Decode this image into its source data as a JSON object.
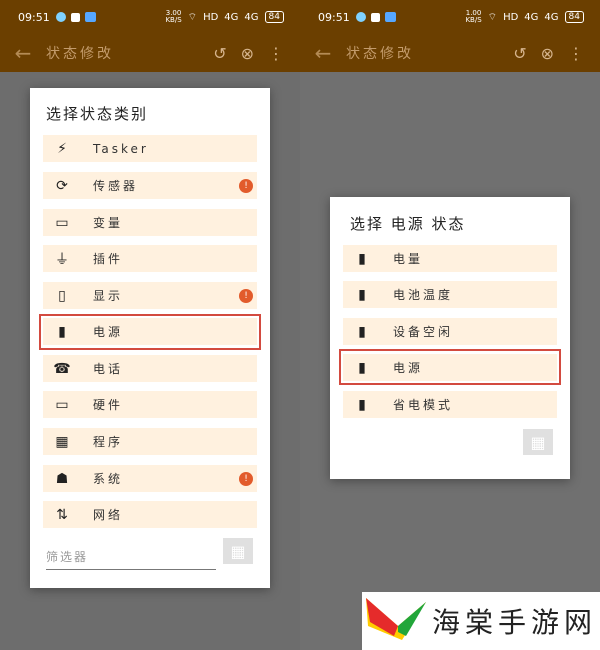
{
  "status_bar": {
    "time": "09:51",
    "left_speed": "3.00\nKB/S",
    "right_speed": "1.00\nKB/S",
    "hd": "HD",
    "signal1": "4G",
    "signal2": "4G",
    "battery": "84"
  },
  "appbar": {
    "title": "状态修改"
  },
  "left_dialog": {
    "title": "选择状态类别",
    "items": [
      {
        "label": "Tasker",
        "icon": "lightning-icon",
        "badge": ""
      },
      {
        "label": "传感器",
        "icon": "rotate-icon",
        "badge": "!"
      },
      {
        "label": "变量",
        "icon": "tag-icon",
        "badge": ""
      },
      {
        "label": "插件",
        "icon": "plug-icon",
        "badge": ""
      },
      {
        "label": "显示",
        "icon": "phone-icon",
        "badge": "!"
      },
      {
        "label": "电源",
        "icon": "battery-icon",
        "badge": ""
      },
      {
        "label": "电话",
        "icon": "phone-call-icon",
        "badge": ""
      },
      {
        "label": "硬件",
        "icon": "laptop-icon",
        "badge": ""
      },
      {
        "label": "程序",
        "icon": "apps-icon",
        "badge": ""
      },
      {
        "label": "系统",
        "icon": "android-icon",
        "badge": "!"
      },
      {
        "label": "网络",
        "icon": "network-arrows-icon",
        "badge": ""
      }
    ],
    "filter_placeholder": "筛选器"
  },
  "right_dialog": {
    "title": "选择 电源 状态",
    "items": [
      {
        "label": "电量",
        "icon": "battery-icon"
      },
      {
        "label": "电池温度",
        "icon": "battery-icon"
      },
      {
        "label": "设备空闲",
        "icon": "battery-icon"
      },
      {
        "label": "电源",
        "icon": "battery-icon"
      },
      {
        "label": "省电模式",
        "icon": "battery-icon"
      }
    ]
  },
  "watermark": {
    "text": "海棠手游网"
  }
}
